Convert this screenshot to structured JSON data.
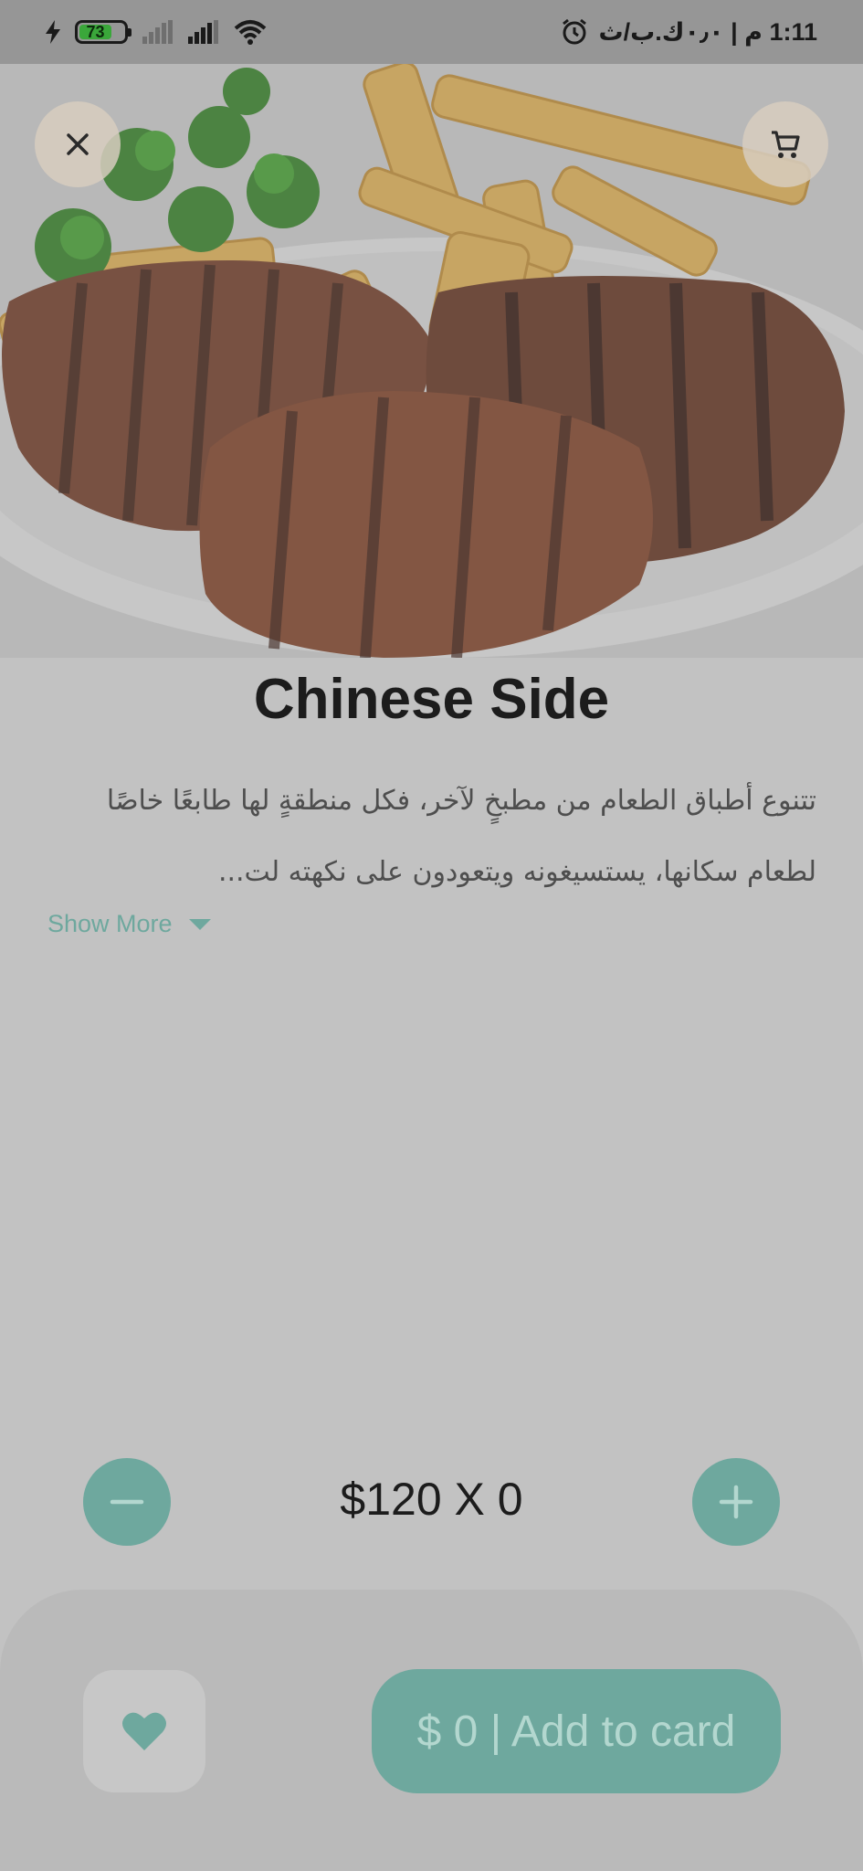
{
  "status_bar": {
    "battery_level": "73",
    "time_text": "1:11 م | ٠٫٠ك.ب/ث",
    "icons": [
      "charging-icon",
      "battery-icon",
      "signal-icon",
      "signal-icon",
      "wifi-icon",
      "alarm-icon"
    ]
  },
  "header": {
    "close_icon": "close-icon",
    "cart_icon": "cart-icon"
  },
  "product": {
    "title": "Chinese Side",
    "description": "تتنوع أطباق الطعام من مطبخٍ لآخر، فكل منطقةٍ لها طابعًا خاصًا لطعام سكانها، يستسيغونه ويتعودون على نكهته لت...",
    "show_more_label": "Show More"
  },
  "quantity": {
    "label": "$120 X 0",
    "minus_icon": "minus-icon",
    "plus_icon": "plus-icon"
  },
  "footer": {
    "favorite_icon": "heart-icon",
    "add_label": "$ 0 | Add to card"
  },
  "colors": {
    "accent": "#6ea89e",
    "background": "#c2c2c2"
  }
}
